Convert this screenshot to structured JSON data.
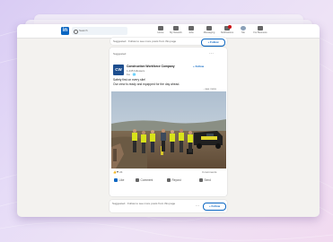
{
  "header": {
    "logo": "in",
    "search_placeholder": "Search",
    "nav": [
      {
        "label": "Home",
        "icon": "home-icon"
      },
      {
        "label": "My Network",
        "icon": "network-icon"
      },
      {
        "label": "Jobs",
        "icon": "jobs-icon"
      },
      {
        "label": "Messaging",
        "icon": "messaging-icon"
      },
      {
        "label": "Notifications",
        "icon": "bell-icon"
      },
      {
        "label": "Me",
        "icon": "avatar-icon"
      },
      {
        "label": "For Business",
        "icon": "grid-icon"
      }
    ]
  },
  "suggested_top": {
    "text": "Suggested · Follow to see more posts from this page",
    "follow": "+ Follow"
  },
  "post": {
    "header_note": "Suggested",
    "company_logo": "CW",
    "company_name": "Construction Workforce Company",
    "meta": "1,245 followers",
    "time": "1w · 🌐",
    "text_line1": "Safety first on every site!",
    "text_line2": "Our crew is ready and equipped for the day ahead.",
    "see_more": "...see more",
    "reactions": "👍❤ 24",
    "comments": "3 comments",
    "actions": [
      {
        "label": "Like",
        "icon": "like-icon"
      },
      {
        "label": "Comment",
        "icon": "comment-icon"
      },
      {
        "label": "Repost",
        "icon": "repost-icon"
      },
      {
        "label": "Send",
        "icon": "send-icon"
      }
    ]
  },
  "suggested_bottom": {
    "text": "Suggested · Follow to see more posts from this page",
    "follow": "+ Follow"
  },
  "colors": {
    "brand": "#0a66c2",
    "vest": "#d8e21a",
    "page_bg": "#f3f2ef"
  }
}
